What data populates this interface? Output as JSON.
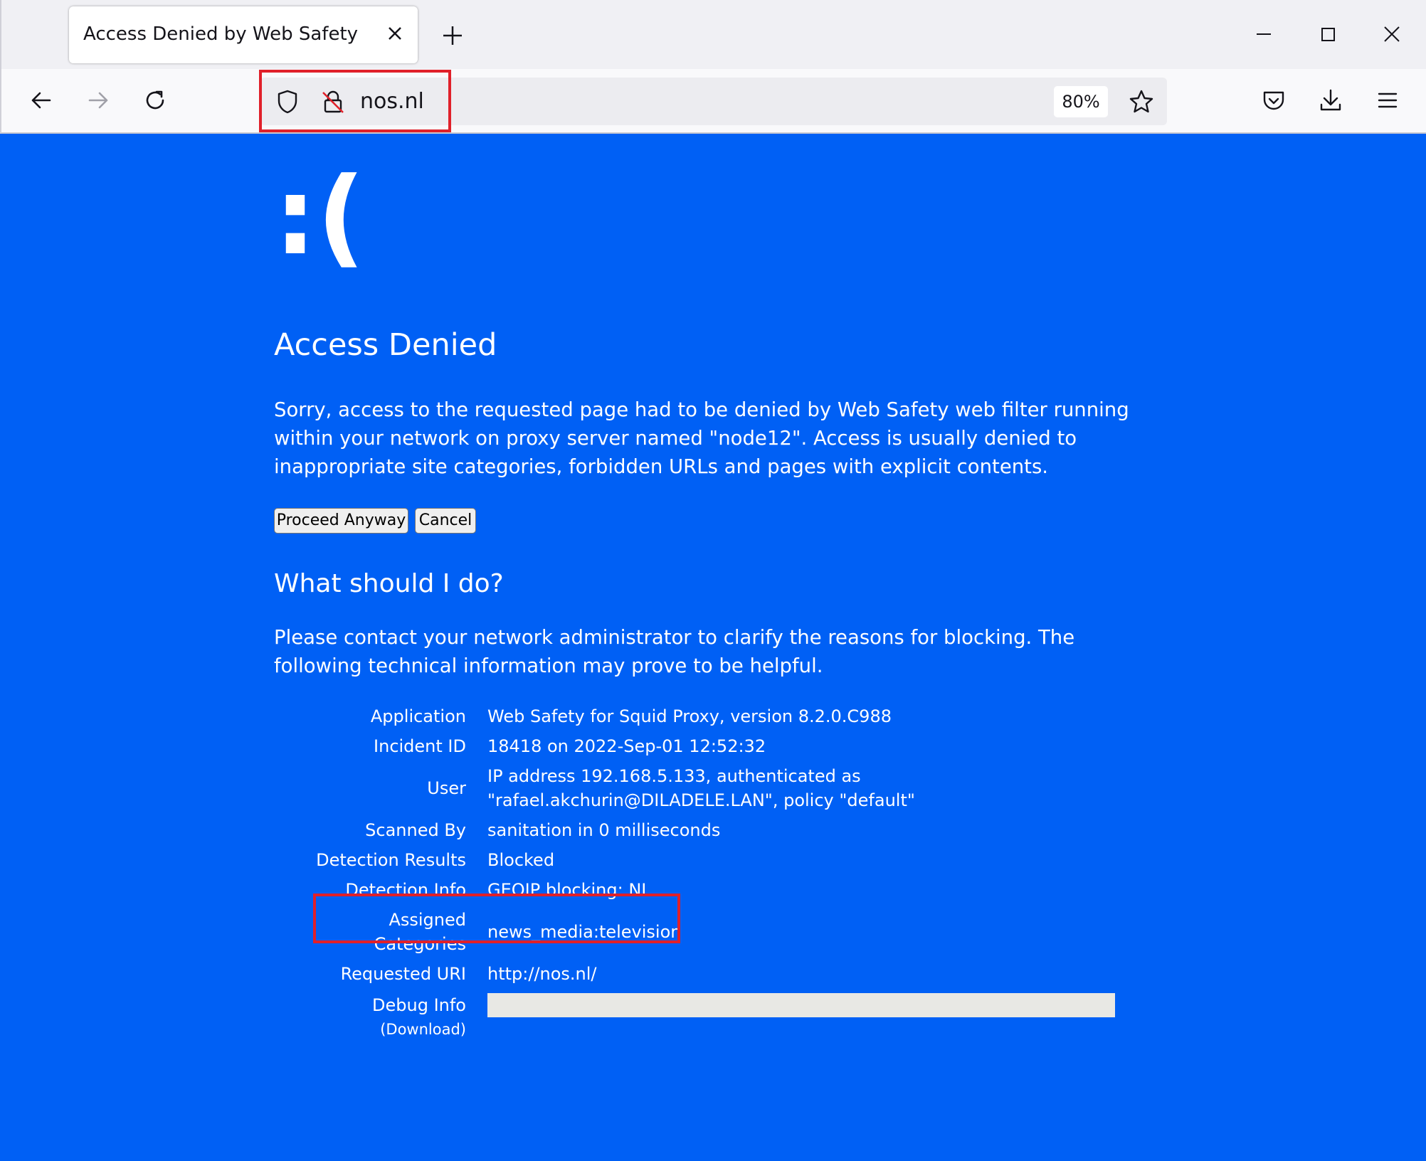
{
  "browser": {
    "tab_title": "Access Denied by Web Safety",
    "url": "nos.nl",
    "zoom": "80%"
  },
  "icons": {
    "tab_close": "close-icon",
    "new_tab": "plus-icon",
    "back": "back-arrow-icon",
    "forward": "forward-arrow-icon",
    "reload": "reload-icon",
    "tracking": "shield-icon",
    "insecure": "broken-lock-icon",
    "bookmark": "star-icon",
    "pocket": "pocket-icon",
    "downloads": "download-icon",
    "menu": "hamburger-icon"
  },
  "page": {
    "sad_face": ":(",
    "title": "Access Denied",
    "description": "Sorry, access to the requested page had to be denied by Web Safety web filter running within your network on proxy server named \"node12\". Access is usually denied to inappropriate site categories, forbidden URLs and pages with explicit contents.",
    "proceed_label": "Proceed Anyway",
    "cancel_label": "Cancel",
    "subtitle": "What should I do?",
    "help_text": "Please contact your network administrator to clarify the reasons for blocking. The following technical information may prove to be helpful."
  },
  "info": {
    "application": {
      "label": "Application",
      "value": "Web Safety for Squid Proxy, version 8.2.0.C988"
    },
    "incident": {
      "label": "Incident ID",
      "value": "18418 on 2022-Sep-01 12:52:32"
    },
    "user": {
      "label": "User",
      "value": "IP address 192.168.5.133, authenticated as \"rafael.akchurin@DILADELE.LAN\", policy \"default\""
    },
    "scanned": {
      "label": "Scanned By",
      "value": "sanitation in 0 milliseconds"
    },
    "results": {
      "label": "Detection Results",
      "value": "Blocked"
    },
    "detinfo": {
      "label": "Detection Info",
      "value": "GEOIP blocking: NL"
    },
    "categories": {
      "label": "Assigned Categories",
      "value": "news_media:television"
    },
    "uri": {
      "label": "Requested URI",
      "value": "http://nos.nl/"
    },
    "debug": {
      "label": "Debug Info",
      "download": "(Download)",
      "value": ""
    }
  },
  "colors": {
    "page_background": "#0060f5",
    "highlight": "#e0202a"
  }
}
